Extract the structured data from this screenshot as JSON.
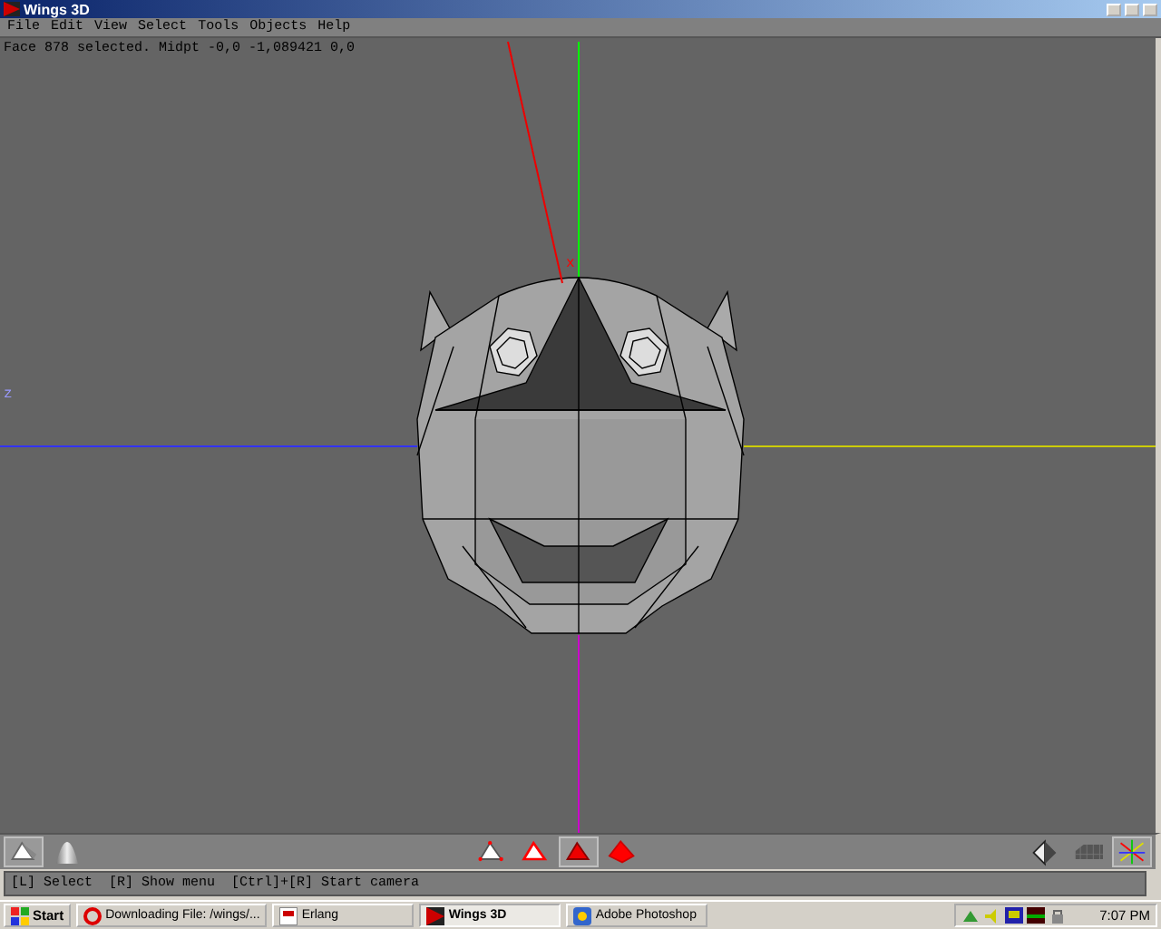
{
  "window": {
    "title": "Wings 3D"
  },
  "menu": [
    "File",
    "Edit",
    "View",
    "Select",
    "Tools",
    "Objects",
    "Help"
  ],
  "viewport": {
    "info": "Face 878 selected. Midpt -0,0 -1,089421 0,0",
    "axis_labels": [
      {
        "kind": "x",
        "text": "x"
      },
      {
        "kind": "z",
        "text": "z"
      }
    ]
  },
  "shading_buttons": [
    {
      "kind": "flat",
      "selected": true
    },
    {
      "kind": "smooth",
      "selected": false
    }
  ],
  "selection_modes": [
    {
      "kind": "vertex",
      "selected": false
    },
    {
      "kind": "edge",
      "selected": false
    },
    {
      "kind": "face",
      "selected": true
    },
    {
      "kind": "body",
      "selected": false
    }
  ],
  "view_buttons": [
    {
      "kind": "wireframe",
      "selected": false
    },
    {
      "kind": "groundplane",
      "selected": false
    },
    {
      "kind": "axes",
      "selected": true
    }
  ],
  "status": "[L] Select  [R] Show menu  [Ctrl]+[R] Start camera",
  "taskbar": {
    "start": "Start",
    "tasks": [
      {
        "label": "Downloading File: /wings/...",
        "selected": false
      },
      {
        "label": "Erlang",
        "selected": false
      },
      {
        "label": "Wings 3D",
        "selected": true
      },
      {
        "label": "Adobe Photoshop",
        "selected": false
      }
    ],
    "clock": "7:07 PM"
  }
}
